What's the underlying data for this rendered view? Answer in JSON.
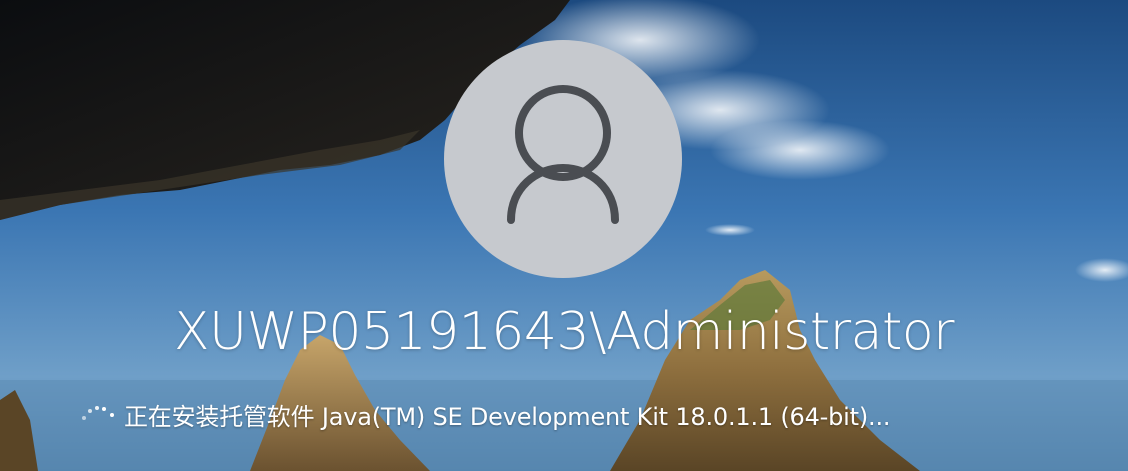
{
  "screen": {
    "account_name": "XUWP05191643\\Administrator",
    "status_message": "正在安装托管软件 Java(TM) SE Development Kit 18.0.1.1 (64-bit)..."
  },
  "icons": {
    "avatar": "user-silhouette-icon",
    "spinner": "loading-spinner-icon"
  },
  "colors": {
    "avatar_circle": "#c6c9ce",
    "avatar_glyph": "#4a4d52",
    "sky_top": "#1f4f86",
    "sky_mid": "#3a74b0",
    "rock_dark": "#14171a",
    "cliff_tan": "#a8894f",
    "text": "#ffffff"
  }
}
